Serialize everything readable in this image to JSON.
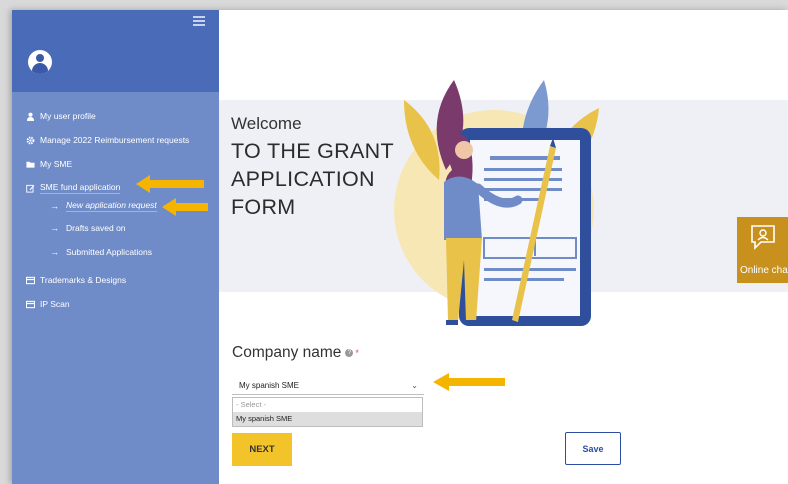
{
  "sidebar": {
    "items": [
      {
        "label": "My user profile",
        "icon": "user-icon"
      },
      {
        "label": "Manage 2022 Reimbursement requests",
        "icon": "gear-icon"
      },
      {
        "label": "My SME",
        "icon": "folder-icon"
      },
      {
        "label": "SME fund application",
        "icon": "edit-icon"
      }
    ],
    "subitems": [
      {
        "label": "New application request"
      },
      {
        "label": "Drafts saved on"
      },
      {
        "label": "Submitted Applications"
      }
    ],
    "bottom_items": [
      {
        "label": "Trademarks & Designs",
        "icon": "card-icon"
      },
      {
        "label": "IP Scan",
        "icon": "card-icon"
      }
    ]
  },
  "hero": {
    "welcome": "Welcome",
    "title": "TO THE GRANT APPLICATION FORM"
  },
  "chat": {
    "label": "Online cha"
  },
  "form": {
    "company_label": "Company name",
    "required_mark": "*",
    "help_glyph": "?",
    "selected_value": "My spanish SME",
    "options": [
      "- Select -",
      "My spanish SME"
    ],
    "next_label": "NEXT",
    "save_label": "Save"
  },
  "colors": {
    "sidebar_bg": "#6f8cc8",
    "sidebar_top": "#4a6bb8",
    "accent_yellow": "#f3c42a",
    "annotation_arrow": "#f5b400",
    "save_border": "#2b4ea3",
    "chat_bg": "#c8901c"
  }
}
